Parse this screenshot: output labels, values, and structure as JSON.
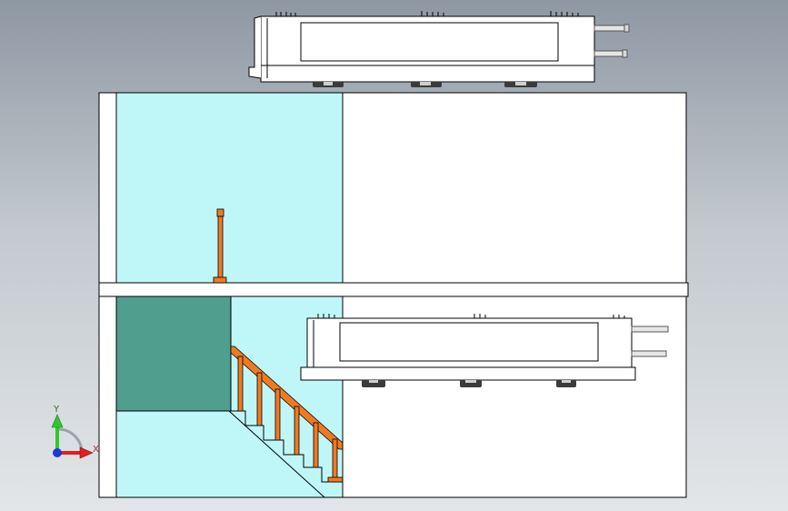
{
  "viewport": {
    "background_top": "#8e98a3",
    "background_bottom": "#e3e6e8"
  },
  "colors": {
    "wall": "#ffffff",
    "room_glass": "#bff7f9",
    "dark_panel": "#4f9e8e",
    "stair_rail": "#f07a22",
    "outline": "#000000",
    "unit_body": "#ffffff",
    "pipe": "#e6e6e6"
  },
  "triad": {
    "y_label": "Y",
    "x_label": "X",
    "y_color": "#2fc82f",
    "x_color": "#e02020",
    "z_color": "#1e3ad8"
  },
  "stairs": {
    "baluster_count": 6
  },
  "pipe_unit": {
    "pipe_count": 2,
    "foot_count": 3
  }
}
